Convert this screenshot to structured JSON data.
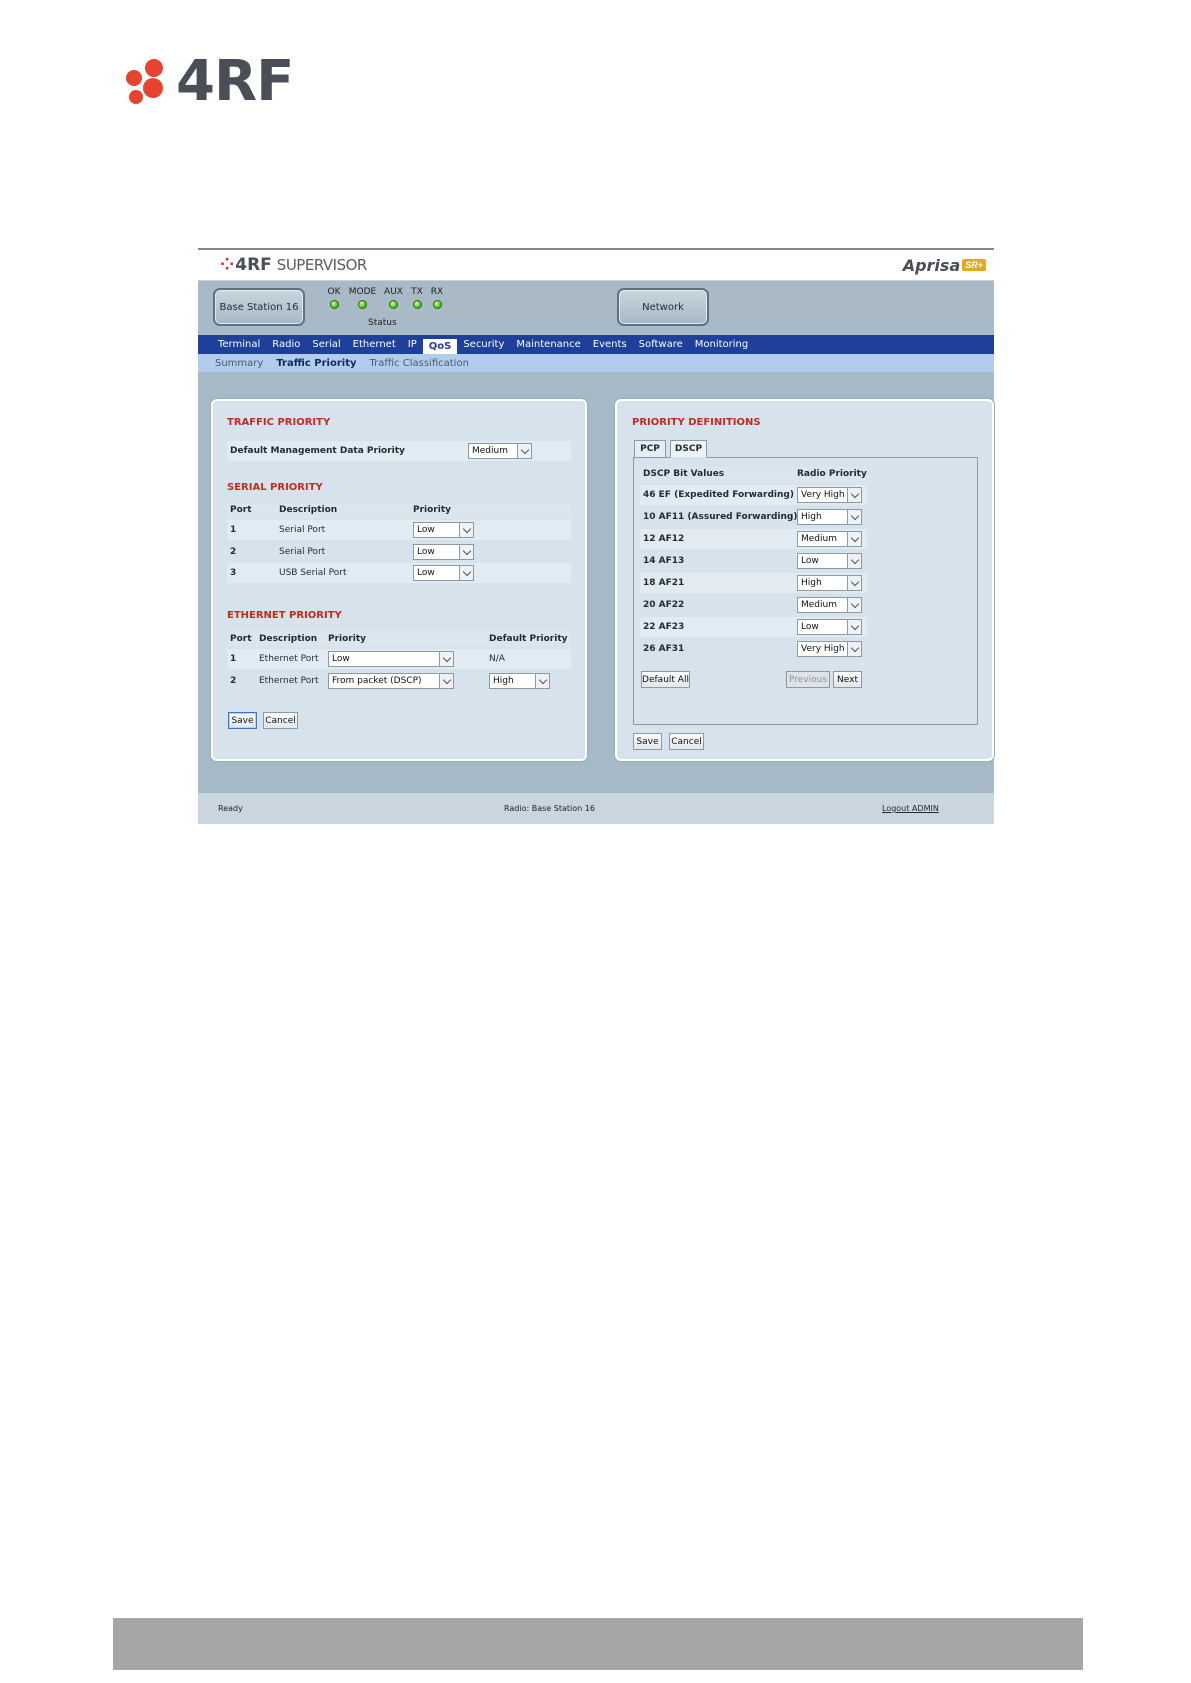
{
  "doc_logo": {
    "text": "4RF"
  },
  "app": {
    "header": {
      "logo_mark": "4RF",
      "logo_sub": "SUPERVISOR",
      "brand": "Aprisa",
      "brand_badge": "SR+"
    },
    "station_button": "Base Station 16",
    "network_button": "Network",
    "leds": [
      {
        "label": "OK"
      },
      {
        "label": "MODE"
      },
      {
        "label": "AUX"
      },
      {
        "label": "TX"
      },
      {
        "label": "RX"
      }
    ],
    "status_label": "Status",
    "menu": [
      "Terminal",
      "Radio",
      "Serial",
      "Ethernet",
      "IP",
      "QoS",
      "Security",
      "Maintenance",
      "Events",
      "Software",
      "Monitoring"
    ],
    "menu_active": "QoS",
    "submenu": [
      "Summary",
      "Traffic Priority",
      "Traffic Classification"
    ],
    "submenu_active": "Traffic Priority",
    "left_panel": {
      "traffic_title": "TRAFFIC PRIORITY",
      "default_mgmt_label": "Default Management Data Priority",
      "default_mgmt_value": "Medium",
      "serial_title": "SERIAL PRIORITY",
      "serial_headers": {
        "port": "Port",
        "description": "Description",
        "priority": "Priority"
      },
      "serial_rows": [
        {
          "port": "1",
          "description": "Serial Port",
          "priority": "Low"
        },
        {
          "port": "2",
          "description": "Serial Port",
          "priority": "Low"
        },
        {
          "port": "3",
          "description": "USB Serial Port",
          "priority": "Low"
        }
      ],
      "ethernet_title": "ETHERNET PRIORITY",
      "ethernet_headers": {
        "port": "Port",
        "description": "Description",
        "priority": "Priority",
        "default_priority": "Default Priority"
      },
      "ethernet_rows": [
        {
          "port": "1",
          "description": "Ethernet Port",
          "priority": "Low",
          "default_priority": "N/A"
        },
        {
          "port": "2",
          "description": "Ethernet Port",
          "priority": "From packet (DSCP)",
          "default_priority": "High"
        }
      ],
      "save": "Save",
      "cancel": "Cancel"
    },
    "right_panel": {
      "title": "PRIORITY DEFINITIONS",
      "tabs": [
        "PCP",
        "DSCP"
      ],
      "tab_active": "DSCP",
      "headers": {
        "bits": "DSCP Bit Values",
        "radio": "Radio Priority"
      },
      "rows": [
        {
          "bits": "46 EF (Expedited Forwarding)",
          "priority": "Very High"
        },
        {
          "bits": "10 AF11 (Assured Forwarding)",
          "priority": "High"
        },
        {
          "bits": "12 AF12",
          "priority": "Medium"
        },
        {
          "bits": "14 AF13",
          "priority": "Low"
        },
        {
          "bits": "18 AF21",
          "priority": "High"
        },
        {
          "bits": "20 AF22",
          "priority": "Medium"
        },
        {
          "bits": "22 AF23",
          "priority": "Low"
        },
        {
          "bits": "26 AF31",
          "priority": "Very High"
        }
      ],
      "default_all": "Default All",
      "previous": "Previous",
      "next": "Next",
      "save": "Save",
      "cancel": "Cancel"
    },
    "footer": {
      "status": "Ready",
      "radio": "Radio: Base Station 16",
      "logout": "Logout ADMIN"
    }
  },
  "colors": {
    "menu_bg": "#1e3f9c",
    "section_title": "#c42a1e",
    "brand_red": "#c8312f",
    "led_green": "#55c02a"
  }
}
